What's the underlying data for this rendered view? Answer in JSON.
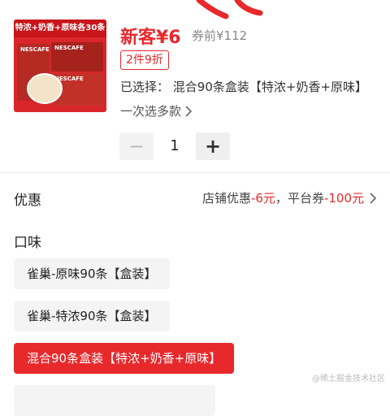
{
  "product": {
    "thumbnail_banner": "特浓+奶香+原味各30条",
    "thumbnail_brand": "NESCAFE",
    "price_label": "新客¥6",
    "original_price_label": "券前¥112",
    "discount_badge": "2件9折",
    "selected_label": "已选择：",
    "selected_value": "混合90条盒装【特浓+奶香+原味】",
    "multi_select_label": "一次选多款"
  },
  "quantity": {
    "minus_symbol": "−",
    "value": "1",
    "plus_symbol": "+"
  },
  "promo": {
    "label": "优惠",
    "store_label": "店铺优惠",
    "store_value": "-6元",
    "separator": "，",
    "platform_label": "平台券",
    "platform_value": "-100元"
  },
  "flavor": {
    "label": "口味",
    "options": [
      {
        "label": "雀巢-原味90条【盒装】",
        "selected": false
      },
      {
        "label": "雀巢-特浓90条【盒装】",
        "selected": false
      },
      {
        "label": "混合90条盒装【特浓+奶香+原味】",
        "selected": true
      },
      {
        "label": "",
        "selected": false
      }
    ]
  },
  "watermark": "@稀土掘金技术社区",
  "colors": {
    "accent": "#e8292c",
    "option_bg": "#f4f4f4",
    "stepper_bg": "#f2f2f2"
  },
  "icons": [
    "chevron-right-icon",
    "minus-icon",
    "plus-icon"
  ]
}
